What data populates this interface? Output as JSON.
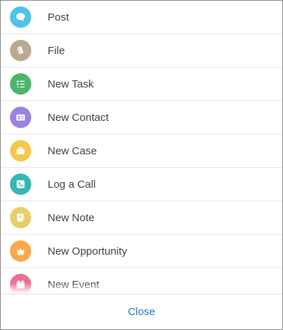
{
  "actions": [
    {
      "label": "Post",
      "icon": "chat-bubble-icon",
      "color": "#4fc3e8"
    },
    {
      "label": "File",
      "icon": "file-icon",
      "color": "#b9a98f"
    },
    {
      "label": "New Task",
      "icon": "task-list-icon",
      "color": "#4bb56a"
    },
    {
      "label": "New Contact",
      "icon": "contact-card-icon",
      "color": "#9b83e0"
    },
    {
      "label": "New Case",
      "icon": "briefcase-icon",
      "color": "#f2c94c"
    },
    {
      "label": "Log a Call",
      "icon": "phone-icon",
      "color": "#32b9b4"
    },
    {
      "label": "New Note",
      "icon": "note-icon",
      "color": "#e6cf6b"
    },
    {
      "label": "New Opportunity",
      "icon": "crown-icon",
      "color": "#f7a94b"
    },
    {
      "label": "New Event",
      "icon": "calendar-icon",
      "color": "#ea6f92"
    }
  ],
  "footer": {
    "close_label": "Close"
  }
}
